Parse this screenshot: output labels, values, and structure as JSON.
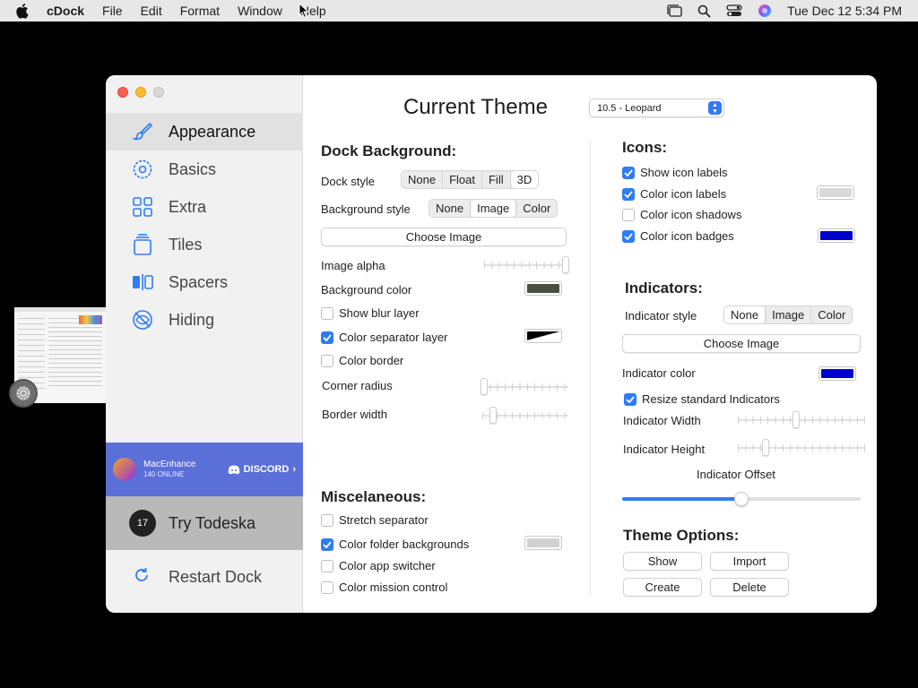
{
  "menubar": {
    "app_name": "cDock",
    "items": [
      "File",
      "Edit",
      "Format",
      "Window",
      "Help"
    ],
    "datetime": "Tue Dec 12  5:34 PM"
  },
  "sidebar": {
    "items": [
      {
        "label": "Appearance",
        "icon": "brush-icon",
        "active": true
      },
      {
        "label": "Basics",
        "icon": "gear-icon",
        "active": false
      },
      {
        "label": "Extra",
        "icon": "grid-icon",
        "active": false
      },
      {
        "label": "Tiles",
        "icon": "tiles-icon",
        "active": false
      },
      {
        "label": "Spacers",
        "icon": "spacers-icon",
        "active": false
      },
      {
        "label": "Hiding",
        "icon": "hidden-eye-icon",
        "active": false
      }
    ],
    "promo": {
      "name": "MacEnhance",
      "online": "140 ONLINE",
      "discord": "DISCORD"
    },
    "todeska": {
      "label": "Try Todeska",
      "badge": "17"
    },
    "restart": {
      "label": "Restart Dock"
    }
  },
  "main": {
    "title": "Current Theme",
    "theme_select": "10.5 - Leopard",
    "dock_background": {
      "heading": "Dock Background:",
      "dock_style_label": "Dock style",
      "dock_style_options": [
        "None",
        "Float",
        "Fill",
        "3D"
      ],
      "dock_style_selected": "3D",
      "bg_style_label": "Background style",
      "bg_style_options": [
        "None",
        "Image",
        "Color"
      ],
      "bg_style_selected": "Image",
      "choose_image": "Choose Image",
      "image_alpha_label": "Image alpha",
      "image_alpha_value": 1.0,
      "bg_color_label": "Background color",
      "show_blur": "Show blur layer",
      "color_separator": "Color separator layer",
      "color_border": "Color border",
      "corner_radius_label": "Corner radius",
      "corner_radius_value": 0.0,
      "border_width_label": "Border width",
      "border_width_value": 0.1
    },
    "misc": {
      "heading": "Miscelaneous:",
      "stretch_separator": "Stretch separator",
      "color_folder_bg": "Color folder backgrounds",
      "color_app_switcher": "Color app switcher",
      "color_mission_control": "Color mission control"
    },
    "icons": {
      "heading": "Icons:",
      "show_labels": "Show icon labels",
      "color_labels": "Color icon labels",
      "color_shadows": "Color icon shadows",
      "color_badges": "Color icon badges"
    },
    "indicators": {
      "heading": "Indicators:",
      "style_label": "Indicator style",
      "style_options": [
        "None",
        "Image",
        "Color"
      ],
      "style_selected": "None",
      "choose_image": "Choose Image",
      "color_label": "Indicator color",
      "resize": "Resize standard Indicators",
      "width_label": "Indicator Width",
      "width_value": 0.45,
      "height_label": "Indicator Height",
      "height_value": 0.22,
      "offset_label": "Indicator Offset",
      "offset_value": 0.5
    },
    "theme_options": {
      "heading": "Theme Options:",
      "show": "Show",
      "import": "Import",
      "create": "Create",
      "delete": "Delete"
    }
  },
  "colors": {
    "accent": "#2f7cf6",
    "bg_color_well": "#4a4f42",
    "label_color_well": "#d9d9d9",
    "badge_color_well": "#0000cc",
    "indicator_color_well": "#0000cc",
    "folder_color_well": "#d0d0d0",
    "promo": "#5b6fd9"
  }
}
